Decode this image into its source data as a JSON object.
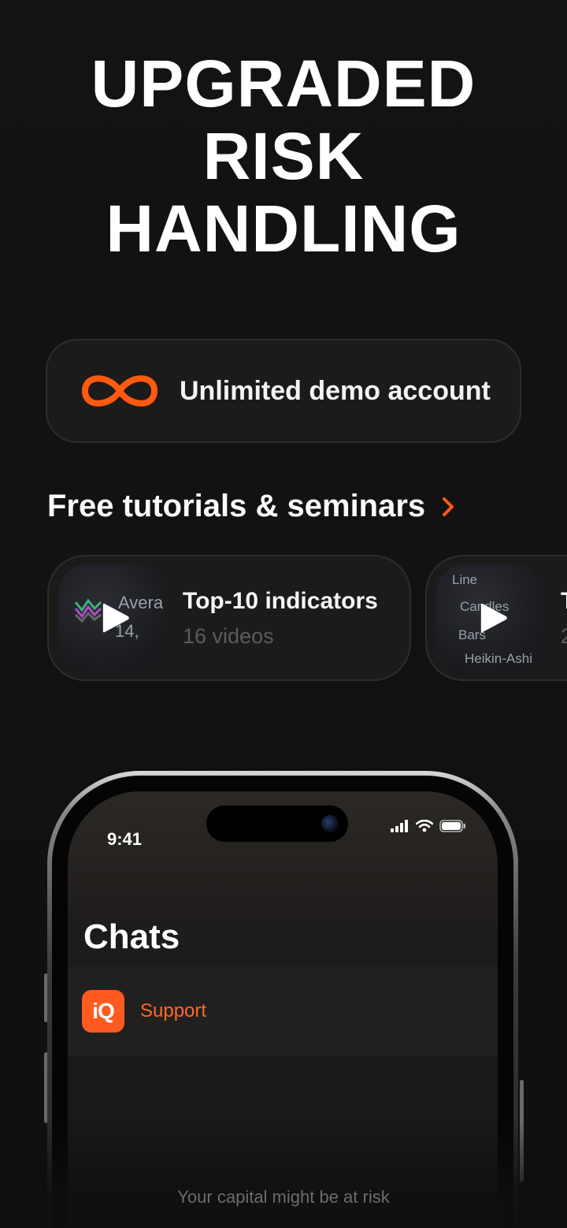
{
  "headline": {
    "line1": "UPGRADED",
    "line2": "RISK",
    "line3": "HANDLING"
  },
  "demo_account": {
    "icon": "infinity-icon",
    "label": "Unlimited demo account",
    "accent_color": "#ff5a0f"
  },
  "tutorials": {
    "section_title": "Free tutorials & seminars",
    "cards": [
      {
        "title": "Top-10 indicators",
        "subtitle": "16 videos",
        "thumb_text_1": "Avera",
        "thumb_text_2": "14,"
      },
      {
        "title": "T",
        "subtitle": "2",
        "thumb_items": [
          "Line",
          "Candles",
          "Bars",
          "Heikin-Ashi"
        ]
      }
    ]
  },
  "phone": {
    "status_time": "9:41",
    "chats_title": "Chats",
    "chat_rows": [
      {
        "name": "Support",
        "avatar_text": "iQ",
        "avatar_color": "#ff5a1f"
      }
    ]
  },
  "footer": {
    "risk_note": "Your capital might be at risk"
  }
}
